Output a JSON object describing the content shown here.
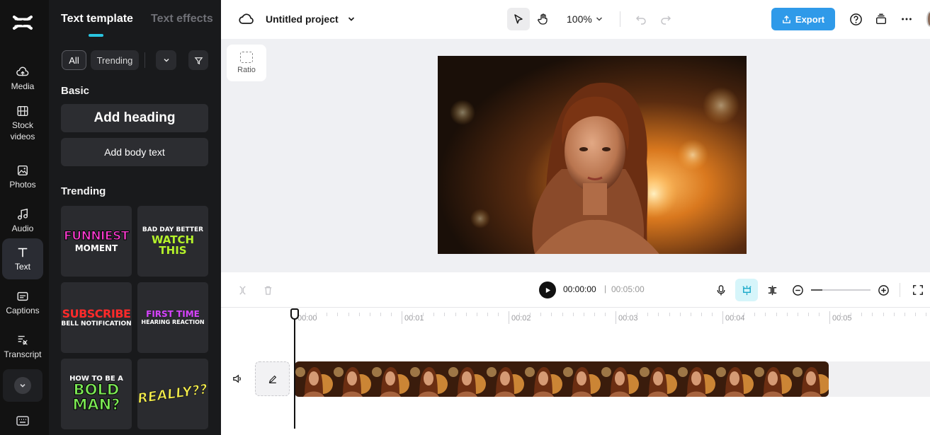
{
  "rail": {
    "items": [
      {
        "label": "Media",
        "icon": "cloud-upload-icon"
      },
      {
        "label": "Stock videos",
        "icon": "film-icon"
      },
      {
        "label": "Photos",
        "icon": "image-icon"
      },
      {
        "label": "Audio",
        "icon": "music-icon"
      },
      {
        "label": "Text",
        "icon": "text-icon",
        "active": true
      },
      {
        "label": "Captions",
        "icon": "captions-icon"
      },
      {
        "label": "Transcript",
        "icon": "transcript-icon"
      }
    ]
  },
  "panel": {
    "tabs": [
      "Text template",
      "Text effects"
    ],
    "filters": {
      "all": "All",
      "trending": "Trending"
    },
    "basic_heading": "Basic",
    "add_heading": "Add heading",
    "add_body": "Add body text",
    "trending_heading": "Trending",
    "templates": [
      {
        "line1": "FUNNIEST",
        "line2": "MOMENT"
      },
      {
        "line1": "BAD DAY BETTER",
        "line2": "WATCH THIS"
      },
      {
        "line1": "SUBSCRIBE",
        "line2": "BELL NOTIFICATION"
      },
      {
        "line1": "FIRST TIME",
        "line2": "HEARING REACTION"
      },
      {
        "line1": "HOW TO BE A",
        "line2": "BOLD",
        "line3": "MAN?"
      },
      {
        "line1": "REALLY??"
      }
    ]
  },
  "topbar": {
    "project_title": "Untitled project",
    "zoom": "100%",
    "export_label": "Export"
  },
  "canvas": {
    "ratio_label": "Ratio"
  },
  "playback": {
    "current_time": "00:00:00",
    "separator": "|",
    "total_time": "00:05:00"
  },
  "timeline": {
    "ticks": [
      "00:00",
      "00:01",
      "00:02",
      "00:03",
      "00:04",
      "00:05"
    ]
  },
  "colors": {
    "accent": "#29c4e0",
    "export": "#2f9ae9",
    "rail_bg": "#121212",
    "panel_bg": "#191a1c"
  }
}
